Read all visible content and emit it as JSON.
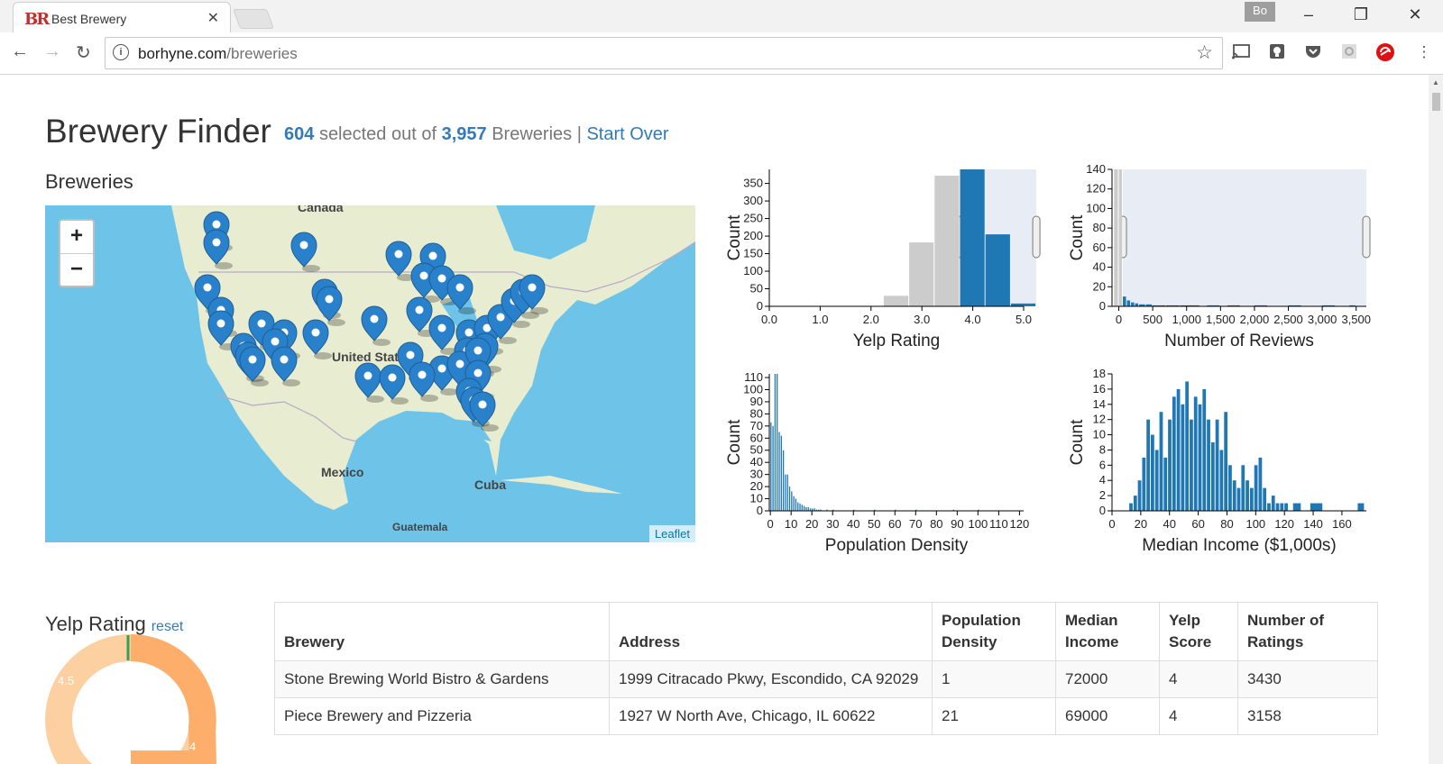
{
  "browser": {
    "tab_title": "Best Brewery",
    "favicon_text": "BR",
    "url_host": "borhyne.com",
    "url_path": "/breweries",
    "profile": "Bo"
  },
  "header": {
    "title": "Brewery Finder",
    "selected": "604",
    "selected_text": "selected out of",
    "total": "3,957",
    "total_text": "Breweries |",
    "start_over": "Start Over"
  },
  "map": {
    "title": "Breweries",
    "labels": [
      "Canada",
      "United States",
      "Mexico",
      "Cuba",
      "Guatemala"
    ],
    "zoom_in": "+",
    "zoom_out": "−",
    "attribution": "Leaflet",
    "marker_icon": "map-marker-icon"
  },
  "yelp_panel": {
    "title": "Yelp Rating",
    "reset": "reset",
    "donut_labels": [
      "4.5",
      "4"
    ]
  },
  "colors": {
    "accent": "#337ab7",
    "bar_selected": "#1f77b4",
    "bar_unselected": "#cccccc",
    "brush": "#e8edf5",
    "donut_light": "#fdd0a2",
    "donut_dark": "#fdae6b",
    "donut_marker": "#31a354"
  },
  "chart_data": [
    {
      "type": "bar",
      "title": "",
      "xlabel": "Yelp Rating",
      "ylabel": "Count",
      "xlim": [
        0,
        5.0
      ],
      "ylim": [
        0,
        390
      ],
      "x_ticks": [
        "0.0",
        "1.0",
        "2.0",
        "3.0",
        "4.0",
        "5.0"
      ],
      "y_ticks": [
        "0",
        "50",
        "100",
        "150",
        "200",
        "250",
        "300",
        "350"
      ],
      "bins": [
        [
          2.25,
          2.75,
          30,
          "unselected"
        ],
        [
          2.75,
          3.25,
          182,
          "unselected"
        ],
        [
          3.25,
          3.75,
          372,
          "unselected"
        ],
        [
          3.75,
          4.25,
          390,
          "selected"
        ],
        [
          4.25,
          4.75,
          205,
          "selected"
        ],
        [
          4.75,
          5.25,
          8,
          "selected"
        ]
      ],
      "brush": [
        3.75,
        5.25
      ]
    },
    {
      "type": "bar",
      "title": "",
      "xlabel": "Number of Reviews",
      "ylabel": "Count",
      "xlim": [
        -100,
        3650
      ],
      "ylim": [
        0,
        140
      ],
      "x_ticks": [
        "0",
        "500",
        "1,000",
        "1,500",
        "2,000",
        "2,500",
        "3,000",
        "3,500"
      ],
      "y_ticks": [
        "0",
        "20",
        "40",
        "60",
        "80",
        "100",
        "120",
        "140"
      ],
      "bins": [
        [
          -70,
          0,
          140,
          "unselected"
        ],
        [
          0,
          60,
          140,
          "unselected"
        ],
        [
          60,
          120,
          10,
          "selected"
        ],
        [
          120,
          180,
          6,
          "selected"
        ],
        [
          180,
          240,
          4,
          "selected"
        ],
        [
          240,
          300,
          3,
          "selected"
        ],
        [
          300,
          400,
          2,
          "selected"
        ],
        [
          400,
          500,
          2,
          "selected"
        ],
        [
          500,
          700,
          1,
          "selected"
        ],
        [
          700,
          900,
          1,
          "selected"
        ],
        [
          900,
          1200,
          1,
          "selected"
        ],
        [
          1300,
          1500,
          1,
          "selected"
        ],
        [
          1600,
          1800,
          1,
          "selected"
        ],
        [
          2000,
          2200,
          1,
          "selected"
        ],
        [
          2500,
          2700,
          1,
          "selected"
        ],
        [
          3000,
          3200,
          1,
          "selected"
        ],
        [
          3400,
          3500,
          1,
          "selected"
        ]
      ],
      "brush": [
        60,
        3650
      ]
    },
    {
      "type": "bar",
      "title": "",
      "xlabel": "Population Density",
      "ylabel": "Count",
      "xlim": [
        -0.5,
        122
      ],
      "ylim": [
        0,
        113
      ],
      "x_ticks": [
        "0",
        "10",
        "20",
        "30",
        "40",
        "50",
        "60",
        "70",
        "80",
        "90",
        "100",
        "110",
        "120"
      ],
      "y_ticks": [
        "0",
        "10",
        "20",
        "30",
        "40",
        "50",
        "60",
        "70",
        "80",
        "90",
        "100",
        "110"
      ],
      "bins": [
        [
          0,
          1,
          73,
          "selected"
        ],
        [
          1,
          2,
          70,
          "selected"
        ],
        [
          2,
          3,
          113,
          "selected"
        ],
        [
          3,
          4,
          113,
          "selected"
        ],
        [
          4,
          5,
          65,
          "selected"
        ],
        [
          5,
          6,
          62,
          "selected"
        ],
        [
          6,
          7,
          50,
          "selected"
        ],
        [
          7,
          8,
          30,
          "selected"
        ],
        [
          8,
          9,
          30,
          "selected"
        ],
        [
          9,
          10,
          20,
          "selected"
        ],
        [
          10,
          11,
          16,
          "selected"
        ],
        [
          11,
          12,
          12,
          "selected"
        ],
        [
          12,
          13,
          10,
          "selected"
        ],
        [
          13,
          14,
          7,
          "selected"
        ],
        [
          14,
          15,
          6,
          "selected"
        ],
        [
          15,
          16,
          5,
          "selected"
        ],
        [
          16,
          17,
          4,
          "selected"
        ],
        [
          17,
          18,
          3,
          "selected"
        ],
        [
          18,
          19,
          3,
          "selected"
        ],
        [
          19,
          20,
          2,
          "selected"
        ],
        [
          20,
          21,
          2,
          "selected"
        ],
        [
          21,
          22,
          2,
          "selected"
        ],
        [
          22,
          23,
          1,
          "selected"
        ],
        [
          23,
          24,
          1,
          "selected"
        ],
        [
          24,
          25,
          1,
          "selected"
        ],
        [
          27,
          28,
          1,
          "selected"
        ],
        [
          30,
          31,
          1,
          "selected"
        ],
        [
          40,
          41,
          1,
          "selected"
        ],
        [
          50,
          51,
          1,
          "selected"
        ],
        [
          60,
          61,
          1,
          "selected"
        ],
        [
          70,
          71,
          1,
          "selected"
        ],
        [
          88,
          89,
          1,
          "selected"
        ],
        [
          100,
          101,
          1,
          "selected"
        ]
      ]
    },
    {
      "type": "bar",
      "title": "",
      "xlabel": "Median Income ($1,000s)",
      "ylabel": "Count",
      "xlim": [
        0,
        177
      ],
      "ylim": [
        0,
        18
      ],
      "x_ticks": [
        "0",
        "20",
        "40",
        "60",
        "80",
        "100",
        "120",
        "140",
        "160"
      ],
      "y_ticks": [
        "0",
        "2",
        "4",
        "6",
        "8",
        "10",
        "12",
        "14",
        "16",
        "18"
      ],
      "bins": [
        [
          12,
          15,
          1,
          "selected"
        ],
        [
          15,
          18,
          2,
          "selected"
        ],
        [
          18,
          21,
          4,
          "selected"
        ],
        [
          21,
          24,
          7,
          "selected"
        ],
        [
          24,
          27,
          12,
          "selected"
        ],
        [
          27,
          30,
          10,
          "selected"
        ],
        [
          30,
          33,
          8,
          "selected"
        ],
        [
          33,
          36,
          13,
          "selected"
        ],
        [
          36,
          39,
          7,
          "selected"
        ],
        [
          39,
          42,
          12,
          "selected"
        ],
        [
          42,
          45,
          15,
          "selected"
        ],
        [
          45,
          48,
          16,
          "selected"
        ],
        [
          48,
          51,
          14,
          "selected"
        ],
        [
          51,
          54,
          17,
          "selected"
        ],
        [
          54,
          57,
          12,
          "selected"
        ],
        [
          57,
          60,
          15,
          "selected"
        ],
        [
          60,
          63,
          14,
          "selected"
        ],
        [
          63,
          66,
          16,
          "selected"
        ],
        [
          66,
          69,
          12,
          "selected"
        ],
        [
          69,
          72,
          9,
          "selected"
        ],
        [
          72,
          75,
          12,
          "selected"
        ],
        [
          75,
          78,
          8,
          "selected"
        ],
        [
          78,
          81,
          13,
          "selected"
        ],
        [
          81,
          84,
          6,
          "selected"
        ],
        [
          84,
          87,
          4,
          "selected"
        ],
        [
          87,
          90,
          3,
          "selected"
        ],
        [
          90,
          93,
          6,
          "selected"
        ],
        [
          93,
          96,
          4,
          "selected"
        ],
        [
          96,
          99,
          3,
          "selected"
        ],
        [
          99,
          102,
          6,
          "selected"
        ],
        [
          102,
          105,
          7,
          "selected"
        ],
        [
          105,
          108,
          3,
          "selected"
        ],
        [
          108,
          111,
          1,
          "selected"
        ],
        [
          111,
          114,
          2,
          "selected"
        ],
        [
          114,
          117,
          1,
          "selected"
        ],
        [
          117,
          120,
          1,
          "selected"
        ],
        [
          120,
          123,
          1,
          "selected"
        ],
        [
          126,
          132,
          1,
          "selected"
        ],
        [
          138,
          147,
          1,
          "selected"
        ],
        [
          171,
          176,
          1,
          "selected"
        ]
      ]
    }
  ],
  "table": {
    "headers": [
      "Brewery",
      "Address",
      "Population Density",
      "Median Income",
      "Yelp Score",
      "Number of Ratings"
    ],
    "rows": [
      [
        "Stone Brewing World Bistro & Gardens",
        "1999 Citracado Pkwy, Escondido, CA 92029",
        "1",
        "72000",
        "4",
        "3430"
      ],
      [
        "Piece Brewery and Pizzeria",
        "1927 W North Ave, Chicago, IL 60622",
        "21",
        "69000",
        "4",
        "3158"
      ]
    ]
  }
}
